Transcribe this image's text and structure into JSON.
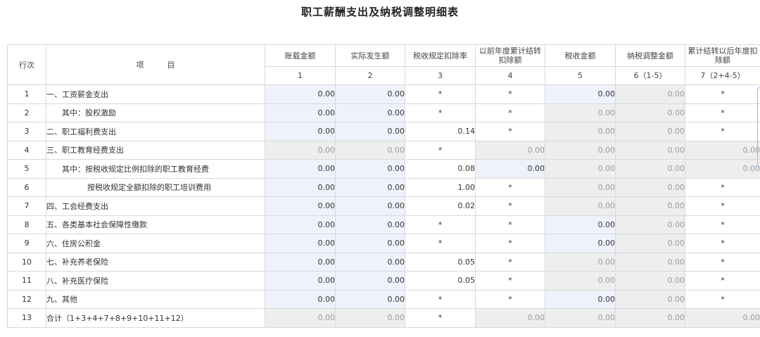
{
  "title": "职工薪酬支出及纳税调整明细表",
  "headers": {
    "row_no": "行次",
    "item": "项　　　目",
    "columns": [
      {
        "label": "账载金额",
        "num": "1"
      },
      {
        "label": "实际发生额",
        "num": "2"
      },
      {
        "label": "税收规定扣除率",
        "num": "3"
      },
      {
        "label": "以前年度累计结转扣除额",
        "num": "4"
      },
      {
        "label": "税收金额",
        "num": "5"
      },
      {
        "label": "纳税调整金额",
        "num": "6（1-5）"
      },
      {
        "label": "累计结转以后年度扣除额",
        "num": "7（2+4-5）"
      }
    ]
  },
  "rows": [
    {
      "no": "1",
      "item": "一、工资薪金支出",
      "indent": 0,
      "cells": [
        [
          "0.00",
          "blue"
        ],
        [
          "0.00",
          "blue"
        ],
        [
          "*",
          "white"
        ],
        [
          "*",
          "white"
        ],
        [
          "0.00",
          "blue"
        ],
        [
          "0.00",
          "gray"
        ],
        [
          "*",
          "white"
        ]
      ]
    },
    {
      "no": "2",
      "item": "其中：股权激励",
      "indent": 1,
      "cells": [
        [
          "0.00",
          "blue"
        ],
        [
          "0.00",
          "blue"
        ],
        [
          "*",
          "white"
        ],
        [
          "*",
          "white"
        ],
        [
          "0.00",
          "gray"
        ],
        [
          "0.00",
          "gray"
        ],
        [
          "*",
          "white"
        ]
      ]
    },
    {
      "no": "3",
      "item": "二、职工福利费支出",
      "indent": 0,
      "cells": [
        [
          "0.00",
          "blue"
        ],
        [
          "0.00",
          "blue"
        ],
        [
          "0.14",
          "white"
        ],
        [
          "*",
          "white"
        ],
        [
          "0.00",
          "gray"
        ],
        [
          "0.00",
          "gray"
        ],
        [
          "*",
          "white"
        ]
      ]
    },
    {
      "no": "4",
      "item": "三、职工教育经费支出",
      "indent": 0,
      "cells": [
        [
          "0.00",
          "gray"
        ],
        [
          "0.00",
          "gray"
        ],
        [
          "*",
          "white"
        ],
        [
          "0.00",
          "gray"
        ],
        [
          "0.00",
          "gray"
        ],
        [
          "0.00",
          "gray"
        ],
        [
          "0.00",
          "gray"
        ]
      ]
    },
    {
      "no": "5",
      "item": "其中：按税收规定比例扣除的职工教育经费",
      "indent": 1,
      "cells": [
        [
          "0.00",
          "blue"
        ],
        [
          "0.00",
          "blue"
        ],
        [
          "0.08",
          "white"
        ],
        [
          "0.00",
          "blue"
        ],
        [
          "0.00",
          "gray"
        ],
        [
          "0.00",
          "gray"
        ],
        [
          "0.00",
          "gray"
        ]
      ]
    },
    {
      "no": "6",
      "item": "按税收规定全额扣除的职工培训费用",
      "indent": 2,
      "cells": [
        [
          "0.00",
          "blue"
        ],
        [
          "0.00",
          "blue"
        ],
        [
          "1.00",
          "white"
        ],
        [
          "*",
          "white"
        ],
        [
          "0.00",
          "gray"
        ],
        [
          "0.00",
          "gray"
        ],
        [
          "*",
          "white"
        ]
      ]
    },
    {
      "no": "7",
      "item": "四、工会经费支出",
      "indent": 0,
      "cells": [
        [
          "0.00",
          "blue"
        ],
        [
          "0.00",
          "blue"
        ],
        [
          "0.02",
          "white"
        ],
        [
          "*",
          "white"
        ],
        [
          "0.00",
          "gray"
        ],
        [
          "0.00",
          "gray"
        ],
        [
          "*",
          "white"
        ]
      ]
    },
    {
      "no": "8",
      "item": "五、各类基本社会保障性缴款",
      "indent": 0,
      "cells": [
        [
          "0.00",
          "blue"
        ],
        [
          "0.00",
          "blue"
        ],
        [
          "*",
          "white"
        ],
        [
          "*",
          "white"
        ],
        [
          "0.00",
          "blue"
        ],
        [
          "0.00",
          "gray"
        ],
        [
          "*",
          "white"
        ]
      ]
    },
    {
      "no": "9",
      "item": "六、住房公积金",
      "indent": 0,
      "cells": [
        [
          "0.00",
          "blue"
        ],
        [
          "0.00",
          "blue"
        ],
        [
          "*",
          "white"
        ],
        [
          "*",
          "white"
        ],
        [
          "0.00",
          "blue"
        ],
        [
          "0.00",
          "gray"
        ],
        [
          "*",
          "white"
        ]
      ]
    },
    {
      "no": "10",
      "item": "七、补充养老保险",
      "indent": 0,
      "cells": [
        [
          "0.00",
          "blue"
        ],
        [
          "0.00",
          "blue"
        ],
        [
          "0.05",
          "white"
        ],
        [
          "*",
          "white"
        ],
        [
          "0.00",
          "gray"
        ],
        [
          "0.00",
          "gray"
        ],
        [
          "*",
          "white"
        ]
      ]
    },
    {
      "no": "11",
      "item": "八、补充医疗保险",
      "indent": 0,
      "cells": [
        [
          "0.00",
          "blue"
        ],
        [
          "0.00",
          "blue"
        ],
        [
          "0.05",
          "white"
        ],
        [
          "*",
          "white"
        ],
        [
          "0.00",
          "gray"
        ],
        [
          "0.00",
          "gray"
        ],
        [
          "*",
          "white"
        ]
      ]
    },
    {
      "no": "12",
      "item": "九、其他",
      "indent": 0,
      "cells": [
        [
          "0.00",
          "blue"
        ],
        [
          "0.00",
          "blue"
        ],
        [
          "*",
          "white"
        ],
        [
          "*",
          "white"
        ],
        [
          "0.00",
          "blue"
        ],
        [
          "0.00",
          "gray"
        ],
        [
          "*",
          "white"
        ]
      ]
    },
    {
      "no": "13",
      "item": "合计（1+3+4+7+8+9+10+11+12）",
      "indent": 0,
      "cells": [
        [
          "0.00",
          "gray"
        ],
        [
          "0.00",
          "gray"
        ],
        [
          "*",
          "white"
        ],
        [
          "0.00",
          "gray"
        ],
        [
          "0.00",
          "gray"
        ],
        [
          "0.00",
          "gray"
        ],
        [
          "0.00",
          "gray"
        ]
      ]
    }
  ],
  "colors": {
    "editable_bg": "#eef3fb",
    "readonly_bg": "#eeeeee",
    "border": "#d9d9d9"
  }
}
